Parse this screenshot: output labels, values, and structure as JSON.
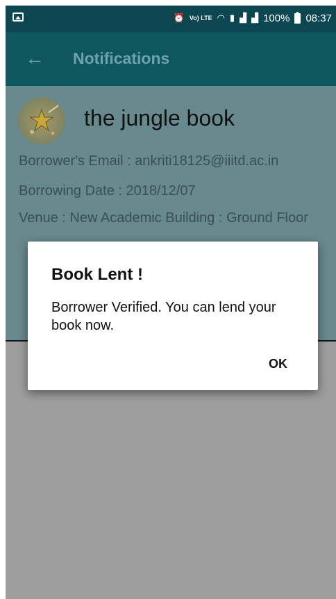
{
  "status_bar": {
    "volte": "Vo) LTE",
    "battery_percent": "100%",
    "time": "08:37"
  },
  "app_bar": {
    "title": "Notifications"
  },
  "notification": {
    "book_title": "the jungle book",
    "email_line": "Borrower's Email : ankriti18125@iiitd.ac.in",
    "date_line": "Borrowing Date : 2018/12/07",
    "venue_line": "Venue : New Academic Building : Ground Floor"
  },
  "dialog": {
    "title": "Book Lent !",
    "message": "Borrower Verified. You can lend your book now.",
    "ok_label": "OK"
  },
  "colors": {
    "status_bar": "#0c4650",
    "app_bar": "#0e5660",
    "card_dimmed": "#68898d",
    "scrim": "#9e9e9e",
    "dialog": "#ffffff"
  }
}
